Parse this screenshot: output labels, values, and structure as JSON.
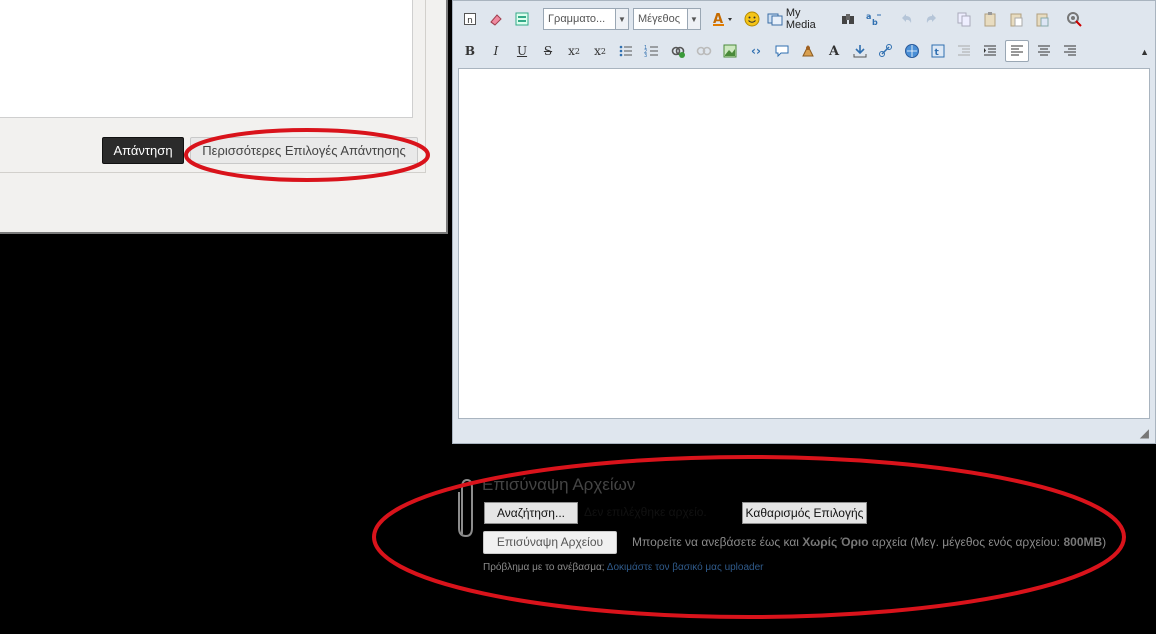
{
  "reply_panel": {
    "reply_button": "Απάντηση",
    "more_options_button": "Περισσότερες Επιλογές Απάντησης"
  },
  "editor": {
    "font_select": "Γραμματο...",
    "size_select": "Μέγεθος",
    "my_media_label": "My Media",
    "toolbar_row1_icons": [
      "source-icon",
      "eraser-icon",
      "layout-icon",
      "font-select",
      "size-select",
      "text-color-icon",
      "smiley-icon",
      "my-media-icon",
      "find-icon",
      "spellcheck-icon",
      "undo-icon",
      "redo-icon",
      "copy-icon",
      "paste-icon",
      "paste-text-icon",
      "paste-word-icon",
      "settings-icon"
    ],
    "toolbar_row2_icons": [
      "bold-icon",
      "italic-icon",
      "underline-icon",
      "strikethrough-icon",
      "subscript-icon",
      "superscript-icon",
      "bullet-list-icon",
      "numbered-list-icon",
      "link-icon",
      "unlink-icon",
      "image-icon",
      "code-icon",
      "quote-icon",
      "spoiler-icon",
      "font-style-icon",
      "insert-icon",
      "hyperlink-icon",
      "web-icon",
      "media-icon",
      "outdent-icon",
      "indent-icon",
      "align-left-icon",
      "align-center-icon",
      "align-right-icon"
    ]
  },
  "attachments": {
    "title": "Επισύναψη Αρχείων",
    "browse_button": "Αναζήτηση...",
    "no_file_text": "Δεν επιλέχθηκε αρχείο.",
    "clear_button": "Καθαρισμός Επιλογής",
    "upload_button": "Επισύναψη Αρχείου",
    "limit_prefix": "Μπορείτε να ανεβάσετε έως και ",
    "limit_bold": "Χωρίς Όριο",
    "limit_mid": " αρχεία (Μεγ. μέγεθος ενός αρχείου: ",
    "limit_size": "800MB",
    "limit_suffix": ")",
    "problem_prefix": "Πρόβλημα με το ανέβασμα;",
    "problem_link": "Δοκιμάστε τον βασικό μας uploader"
  },
  "colors": {
    "annotation": "#d9131b",
    "reply_button_bg": "#2b2b2b",
    "link": "#2f5a8a"
  }
}
